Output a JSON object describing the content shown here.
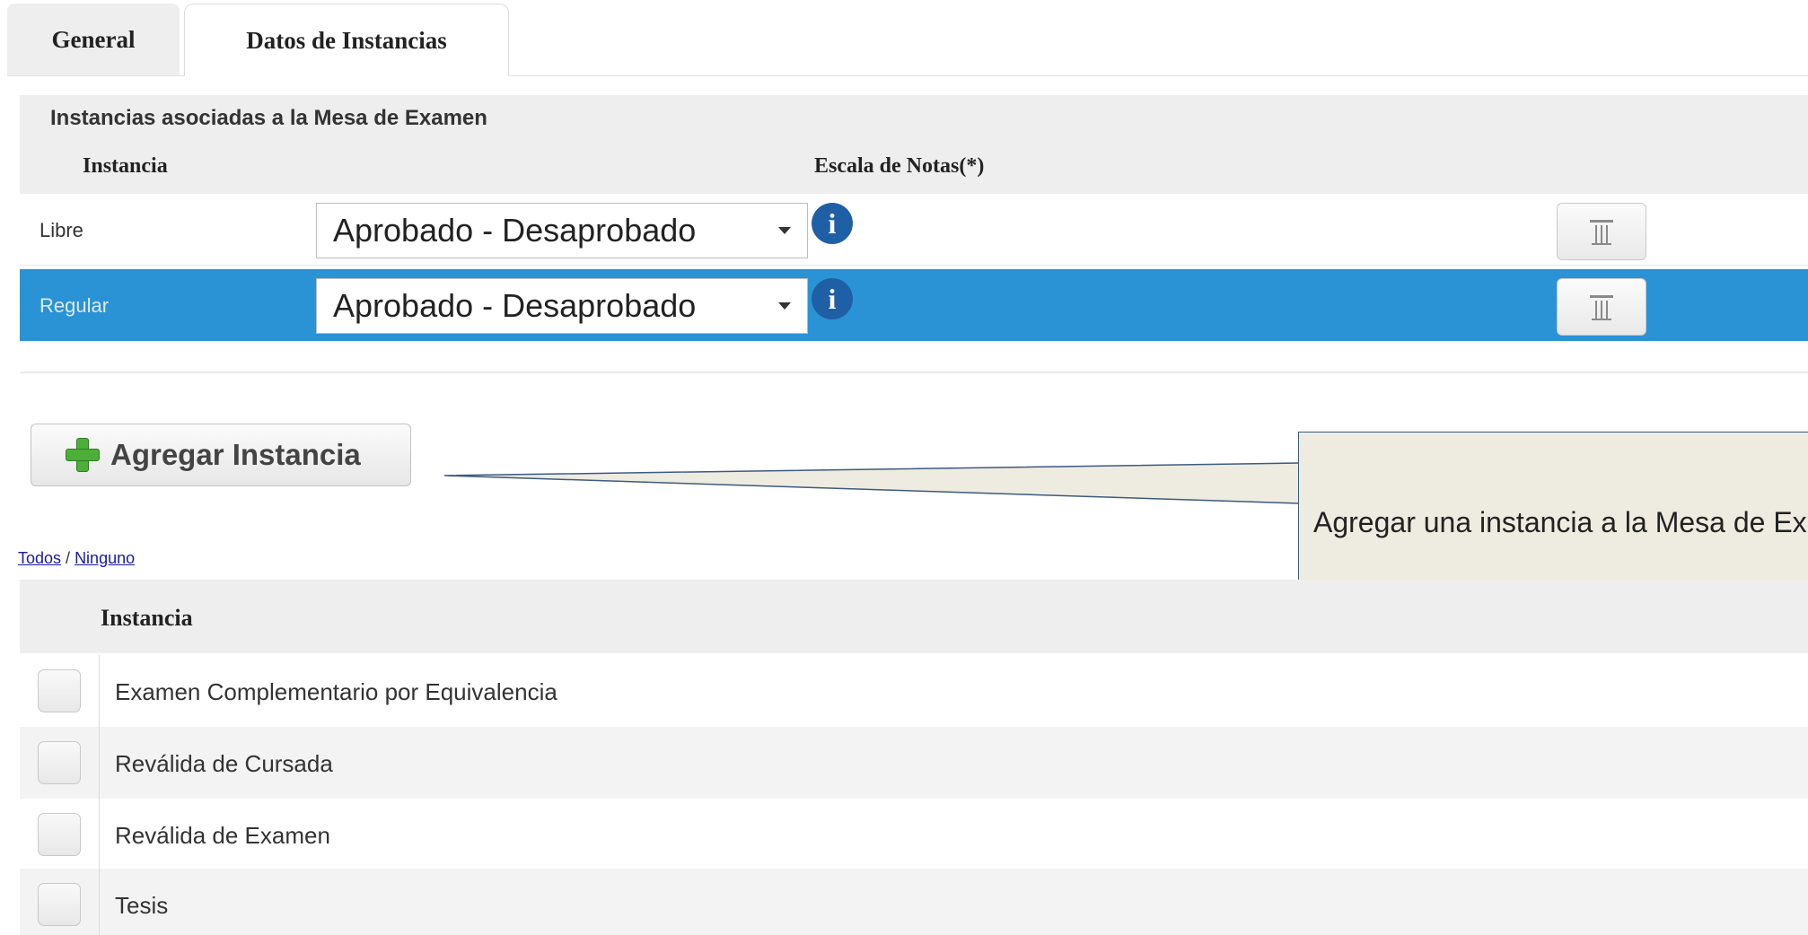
{
  "tabs": [
    {
      "label": "General",
      "active": false
    },
    {
      "label": "Datos de Instancias",
      "active": true
    }
  ],
  "panel": {
    "title": "Instancias asociadas a la Mesa de Examen",
    "col_instancia": "Instancia",
    "col_escala": "Escala de Notas(*)"
  },
  "instances": [
    {
      "label": "Libre",
      "escala": "Aprobado - Desaprobado",
      "selected": false
    },
    {
      "label": "Regular",
      "escala": "Aprobado - Desaprobado",
      "selected": true
    }
  ],
  "colors": {
    "selected_row": "#2a93d5",
    "info_icon": "#1f5fa6",
    "add_icon": "#4caf3a",
    "callout_bg": "#eeebe0"
  },
  "add_button": {
    "label": "Agregar Instancia",
    "icon": "plus-icon"
  },
  "callout": {
    "text": "Agregar una instancia a la Mesa de Examen"
  },
  "selection_links": {
    "all": "Todos",
    "separator": " / ",
    "none": "Ninguno"
  },
  "table": {
    "header": "Instancia",
    "rows": [
      {
        "label": "Examen Complementario por Equivalencia",
        "checked": false
      },
      {
        "label": "Reválida de Cursada",
        "checked": false
      },
      {
        "label": "Reválida de Examen",
        "checked": false
      },
      {
        "label": "Tesis",
        "checked": false
      }
    ]
  }
}
